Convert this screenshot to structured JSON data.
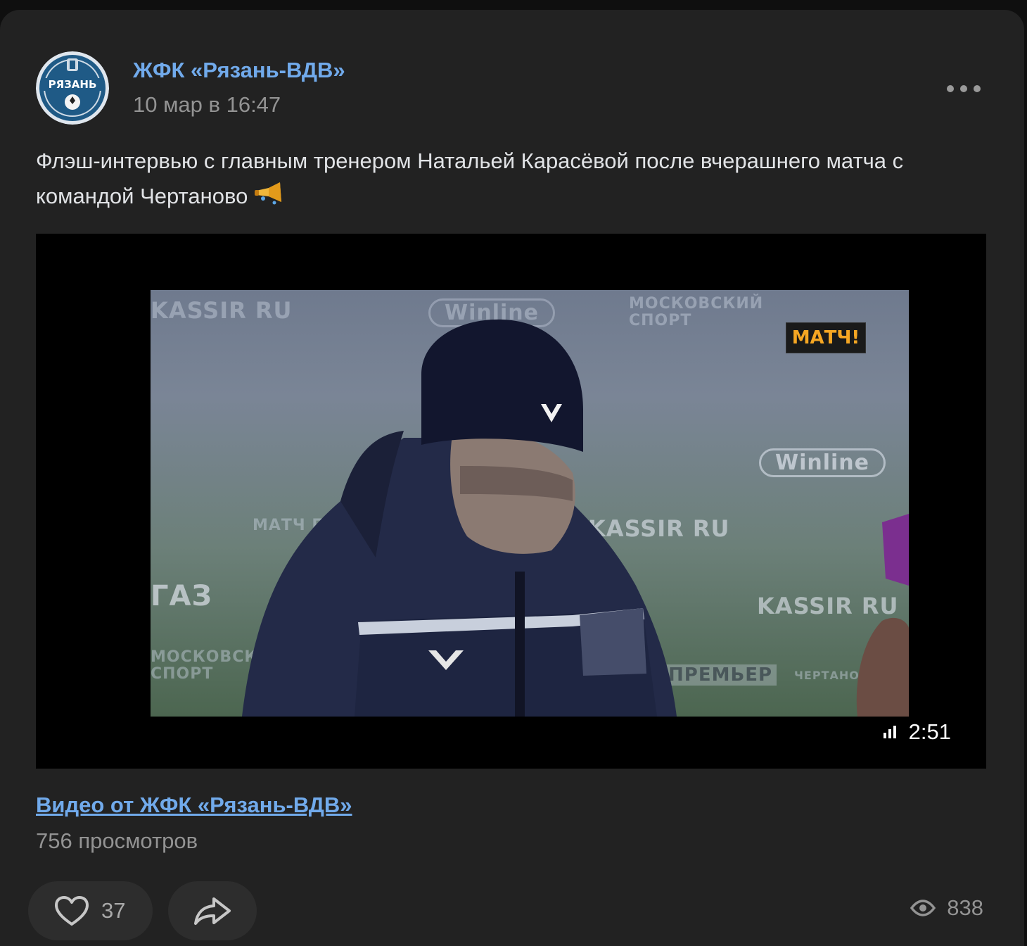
{
  "post": {
    "author": "ЖФК «Рязань-ВДВ»",
    "avatar_text": "РЯЗАНЬ",
    "date": "10 мар в 16:47",
    "text": "Флэш-интервью с главным тренером Натальей Карасёвой после вчерашнего матча с командой Чертаново",
    "text_emoji": "trumpet-icon"
  },
  "video": {
    "channel_logo": "МАТЧ!",
    "duration": "2:51",
    "source_label": "Видео от ЖФК «Рязань-ВДВ»",
    "views_label": "756 просмотров",
    "backdrop_logos": [
      "KASSIR RU",
      "Winline",
      "МОСКОВСКИЙ СПОРТ",
      "ПРЕМЬЕР",
      "ЧЕРТАНОВО",
      "МАТЧ ПРЕМЬЕР",
      "ГАЗ"
    ]
  },
  "actions": {
    "like_count": "37",
    "view_count": "838"
  },
  "colors": {
    "background": "#222222",
    "link": "#71aaeb",
    "muted": "#939393",
    "pill": "#2d2d2d"
  }
}
